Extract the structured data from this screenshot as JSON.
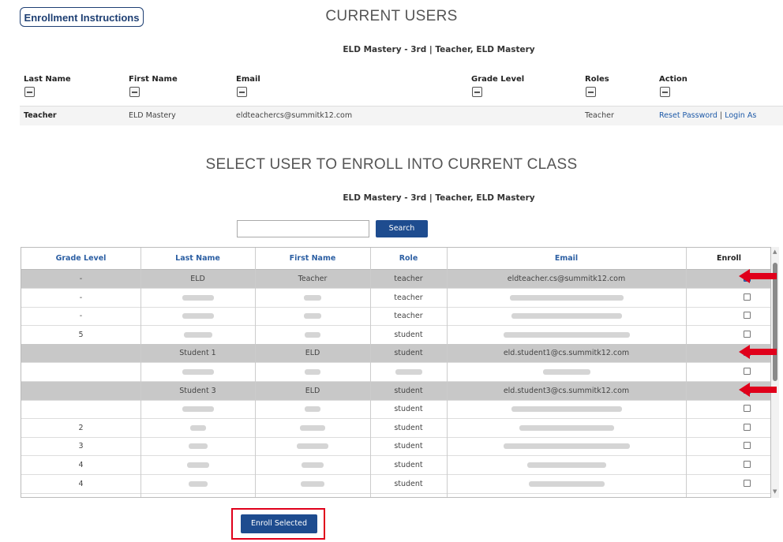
{
  "top": {
    "instructions_button": "Enrollment Instructions",
    "current_users_title": "CURRENT USERS",
    "class_subtitle": "ELD Mastery - 3rd | Teacher, ELD Mastery"
  },
  "current_users": {
    "columns": [
      "Last Name",
      "First Name",
      "Email",
      "Grade Level",
      "Roles",
      "Action"
    ],
    "row": {
      "last_name": "Teacher",
      "first_name": "ELD Mastery",
      "email": "eldteachercs@summitk12.com",
      "grade": "",
      "role": "Teacher",
      "action_reset": "Reset Password",
      "action_sep": " | ",
      "action_login": "Login As"
    }
  },
  "enroll": {
    "title": "SELECT USER TO ENROLL INTO CURRENT CLASS",
    "subtitle": "ELD Mastery - 3rd | Teacher, ELD Mastery",
    "search_value": "",
    "search_button": "Search",
    "columns": [
      "Grade Level",
      "Last Name",
      "First Name",
      "Role",
      "Email",
      "Enroll"
    ],
    "rows": [
      {
        "grade": "-",
        "last": "ELD",
        "first": "Teacher",
        "role": "teacher",
        "email": "eldteacher.cs@summitk12.com",
        "checked": true
      },
      {
        "grade": "-",
        "last": "",
        "first": "",
        "role": "teacher",
        "email": "",
        "checked": false
      },
      {
        "grade": "-",
        "last": "",
        "first": "",
        "role": "teacher",
        "email": "",
        "checked": false
      },
      {
        "grade": "5",
        "last": "",
        "first": "",
        "role": "student",
        "email": "",
        "checked": false
      },
      {
        "grade": "",
        "last": "Student 1",
        "first": "ELD",
        "role": "student",
        "email": "eld.student1@cs.summitk12.com",
        "checked": true
      },
      {
        "grade": "",
        "last": "",
        "first": "",
        "role": "",
        "email": "",
        "checked": false
      },
      {
        "grade": "",
        "last": "Student 3",
        "first": "ELD",
        "role": "student",
        "email": "eld.student3@cs.summitk12.com",
        "checked": true
      },
      {
        "grade": "",
        "last": "",
        "first": "",
        "role": "student",
        "email": "",
        "checked": false
      },
      {
        "grade": "2",
        "last": "",
        "first": "",
        "role": "student",
        "email": "",
        "checked": false
      },
      {
        "grade": "3",
        "last": "",
        "first": "",
        "role": "student",
        "email": "",
        "checked": false
      },
      {
        "grade": "4",
        "last": "",
        "first": "",
        "role": "student",
        "email": "",
        "checked": false
      },
      {
        "grade": "4",
        "last": "",
        "first": "",
        "role": "student",
        "email": "",
        "checked": false
      }
    ],
    "enroll_button": "Enroll Selected"
  },
  "colors": {
    "primary": "#1e4c8f",
    "header_text": "#2c5fa3",
    "selected_row": "#c8c8c8",
    "annotation_red": "#e0001b"
  }
}
